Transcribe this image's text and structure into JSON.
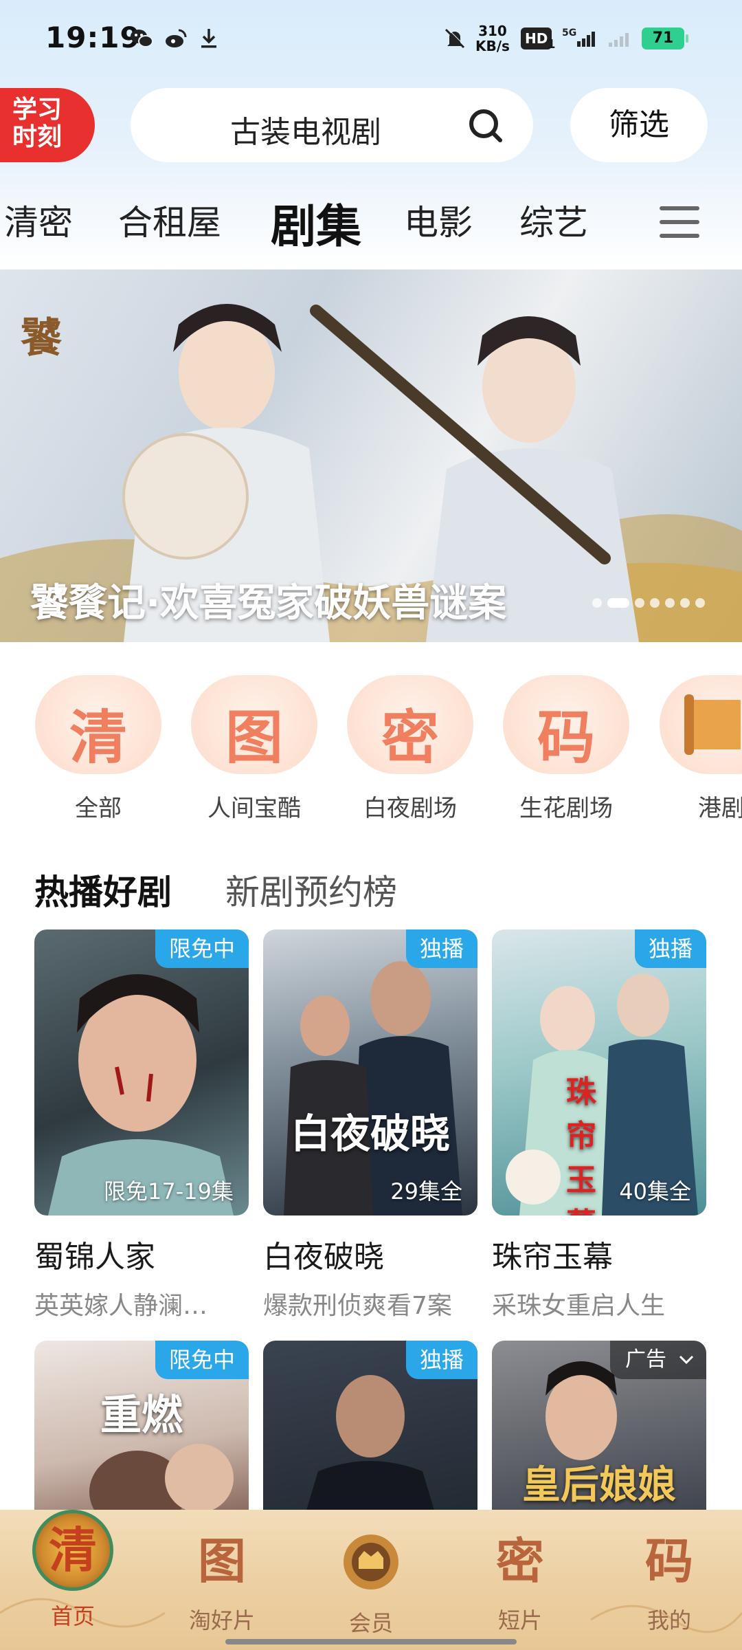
{
  "status_bar": {
    "time": "19:19",
    "net_speed_value": "310",
    "net_speed_unit": "KB/s",
    "hd_label": "HD",
    "sim": "1",
    "network": "5G",
    "battery": "71",
    "battery_color": "#2fd08f"
  },
  "header": {
    "study_badge": "学习时刻",
    "search_text": "古装电视剧",
    "filter_label": "筛选",
    "brand_accent": "#e8302f"
  },
  "tabs": [
    {
      "label": "清密",
      "active": false
    },
    {
      "label": "合租屋",
      "active": false
    },
    {
      "label": "剧集",
      "active": true
    },
    {
      "label": "电影",
      "active": false
    },
    {
      "label": "综艺",
      "active": false
    }
  ],
  "banner": {
    "title": "饕餮记·欢喜冤家破妖兽谜案",
    "dot_count": 7,
    "active_dot": 1
  },
  "channels": [
    {
      "glyph": "清",
      "label": "全部"
    },
    {
      "glyph": "图",
      "label": "人间宝酷"
    },
    {
      "glyph": "密",
      "label": "白夜剧场"
    },
    {
      "glyph": "码",
      "label": "生花剧场"
    },
    {
      "glyph": "",
      "label": "港剧"
    }
  ],
  "section": {
    "tab_hot": "热播好剧",
    "tab_new": "新剧预约榜"
  },
  "cards": [
    {
      "tag": "限免中",
      "eps": "限免17-19集",
      "title": "蜀锦人家",
      "subtitle": "英英嫁人静澜…"
    },
    {
      "tag": "独播",
      "eps": "29集全",
      "title": "白夜破晓",
      "subtitle": "爆款刑侦爽看7案",
      "poster_text": "白夜破晓"
    },
    {
      "tag": "独播",
      "eps": "40集全",
      "title": "珠帘玉幕",
      "subtitle": "采珠女重启人生",
      "poster_text": "珠帘玉幕"
    },
    {
      "tag": "限免中",
      "poster_text": "重燃"
    },
    {
      "tag": "独播"
    },
    {
      "ad": "广告",
      "poster_text": "皇后娘娘"
    }
  ],
  "bottom_nav": [
    {
      "glyph": "清",
      "label": "首页",
      "active": true
    },
    {
      "glyph": "图",
      "label": "淘好片",
      "active": false
    },
    {
      "glyph": "",
      "label": "会员",
      "active": false
    },
    {
      "glyph": "密",
      "label": "短片",
      "active": false
    },
    {
      "glyph": "码",
      "label": "我的",
      "active": false
    }
  ],
  "icons": [
    "wechat-icon",
    "weibo-icon",
    "download-icon",
    "mute-icon",
    "signal-icon",
    "search-icon",
    "menu-icon",
    "chevron-down-icon",
    "vip-emblem-icon"
  ]
}
